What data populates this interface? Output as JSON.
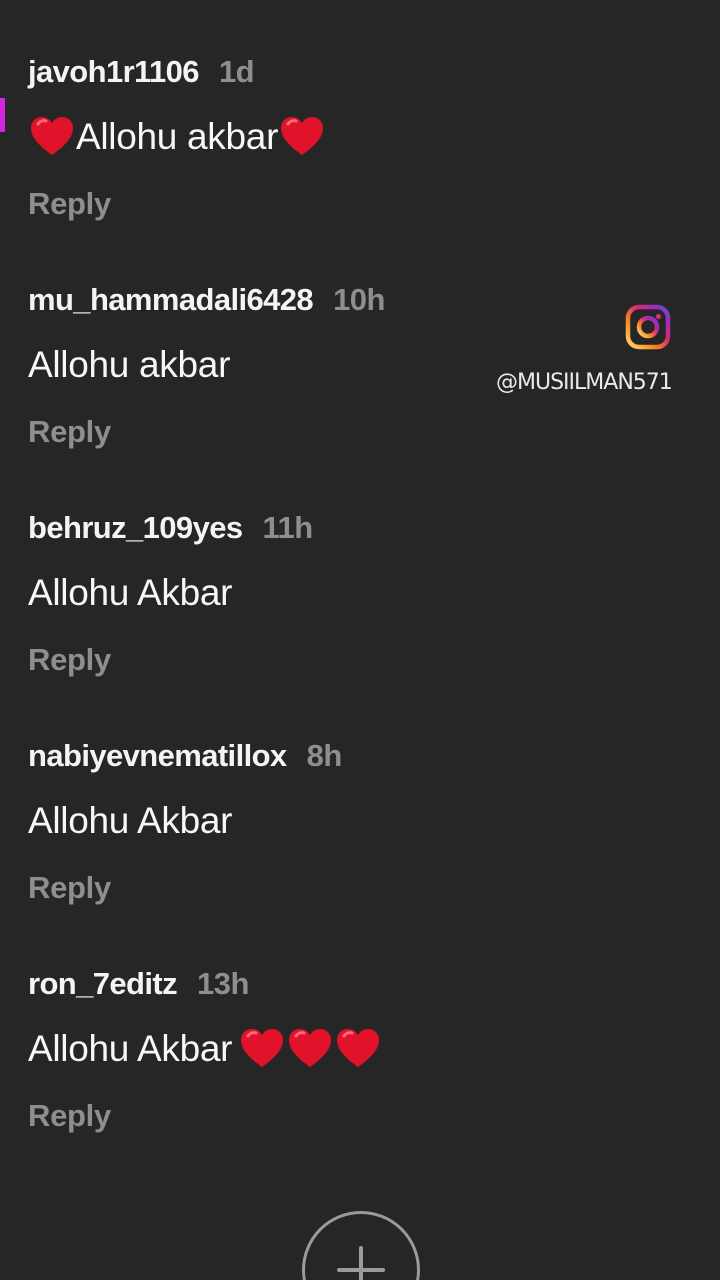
{
  "comments": [
    {
      "username": "javoh1r1106",
      "time": "1d",
      "text": "Allohu akbar",
      "reply": "Reply"
    },
    {
      "username": "mu_hammadali6428",
      "time": "10h",
      "text": "Allohu akbar",
      "reply": "Reply"
    },
    {
      "username": "behruz_109yes",
      "time": "11h",
      "text": "Allohu Akbar",
      "reply": "Reply"
    },
    {
      "username": "nabiyevnematillox",
      "time": "8h",
      "text": "Allohu Akbar",
      "reply": "Reply"
    },
    {
      "username": "ron_7editz",
      "time": "13h",
      "text": "Allohu Akbar",
      "reply": "Reply"
    }
  ],
  "watermark": {
    "icon": "instagram-icon",
    "handle": "@MUSIILMAN571"
  },
  "add_button": {
    "icon": "plus-icon"
  },
  "icons": {
    "heart": "red-heart-emoji"
  },
  "colors": {
    "background": "#262626",
    "username": "#f4f4f4",
    "muted": "#8e8e8e",
    "heart": "#e0132a",
    "accent_edge": "#d026e0"
  }
}
